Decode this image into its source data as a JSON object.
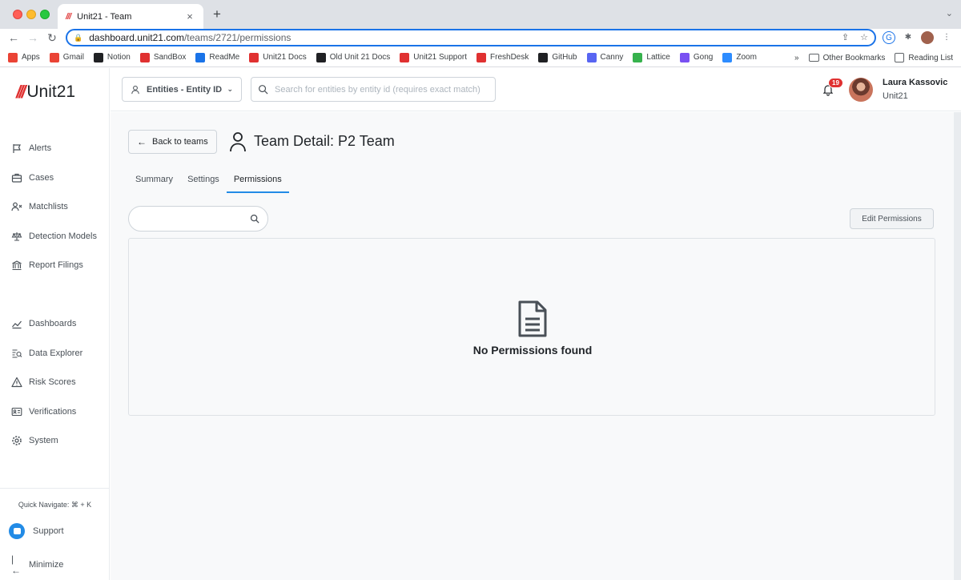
{
  "browser": {
    "tab_title": "Unit21 - Team",
    "tab_favicon": "///",
    "tab_close": "×",
    "new_tab": "+",
    "tab_menu": "⌄",
    "url_host": "dashboard.unit21.com",
    "url_path": "/teams/2721/permissions",
    "bookmarks": [
      {
        "label": "Apps",
        "icon": "apps-grid-icon",
        "color": "#ea4335"
      },
      {
        "label": "Gmail",
        "icon": "gmail-icon",
        "color": "#ea4335"
      },
      {
        "label": "Notion",
        "icon": "notion-icon",
        "color": "#202124"
      },
      {
        "label": "SandBox",
        "icon": "unit21-icon",
        "color": "#e03131"
      },
      {
        "label": "ReadMe",
        "icon": "readme-icon",
        "color": "#1a73e8"
      },
      {
        "label": "Unit21 Docs",
        "icon": "unit21-icon",
        "color": "#e03131"
      },
      {
        "label": "Old Unit 21 Docs",
        "icon": "globe-icon",
        "color": "#202124"
      },
      {
        "label": "Unit21 Support",
        "icon": "unit21-icon",
        "color": "#e03131"
      },
      {
        "label": "FreshDesk",
        "icon": "freshdesk-icon",
        "color": "#e03131"
      },
      {
        "label": "GitHub",
        "icon": "github-icon",
        "color": "#202124"
      },
      {
        "label": "Canny",
        "icon": "canny-icon",
        "color": "#5865f2"
      },
      {
        "label": "Lattice",
        "icon": "lattice-icon",
        "color": "#37b24d"
      },
      {
        "label": "Gong",
        "icon": "gong-icon",
        "color": "#7950f2"
      },
      {
        "label": "Zoom",
        "icon": "zoom-icon",
        "color": "#2d8cff"
      }
    ],
    "bookmarks_overflow": "»",
    "other_bookmarks": "Other Bookmarks",
    "reading_list": "Reading List"
  },
  "sidebar": {
    "logo_mark": "///",
    "logo_text": "Unit21",
    "items_top": [
      {
        "label": "Alerts",
        "icon": "flag-icon"
      },
      {
        "label": "Cases",
        "icon": "briefcase-icon"
      },
      {
        "label": "Matchlists",
        "icon": "user-x-icon"
      },
      {
        "label": "Detection Models",
        "icon": "scale-icon"
      },
      {
        "label": "Report Filings",
        "icon": "bank-icon"
      }
    ],
    "items_bottom": [
      {
        "label": "Dashboards",
        "icon": "line-chart-icon"
      },
      {
        "label": "Data Explorer",
        "icon": "data-search-icon"
      },
      {
        "label": "Risk Scores",
        "icon": "warning-icon"
      },
      {
        "label": "Verifications",
        "icon": "id-card-icon"
      },
      {
        "label": "System",
        "icon": "gear-icon"
      }
    ],
    "quick_navigate": "Quick Navigate: ⌘ + K",
    "support": "Support",
    "minimize": "Minimize"
  },
  "header": {
    "entity_select": "Entities - Entity ID",
    "search_placeholder": "Search for entities by entity id (requires exact match)",
    "notification_count": "19",
    "user_name": "Laura Kassovic",
    "user_org": "Unit21"
  },
  "page": {
    "back_label": "Back to teams",
    "title": "Team Detail: P2 Team",
    "tabs": [
      {
        "label": "Summary",
        "active": false
      },
      {
        "label": "Settings",
        "active": false
      },
      {
        "label": "Permissions",
        "active": true
      }
    ],
    "search_value": "",
    "edit_permissions": "Edit Permissions",
    "empty_message": "No Permissions found"
  },
  "colors": {
    "brand": "#e03131",
    "accent": "#228be6",
    "badge": "#e03131"
  }
}
